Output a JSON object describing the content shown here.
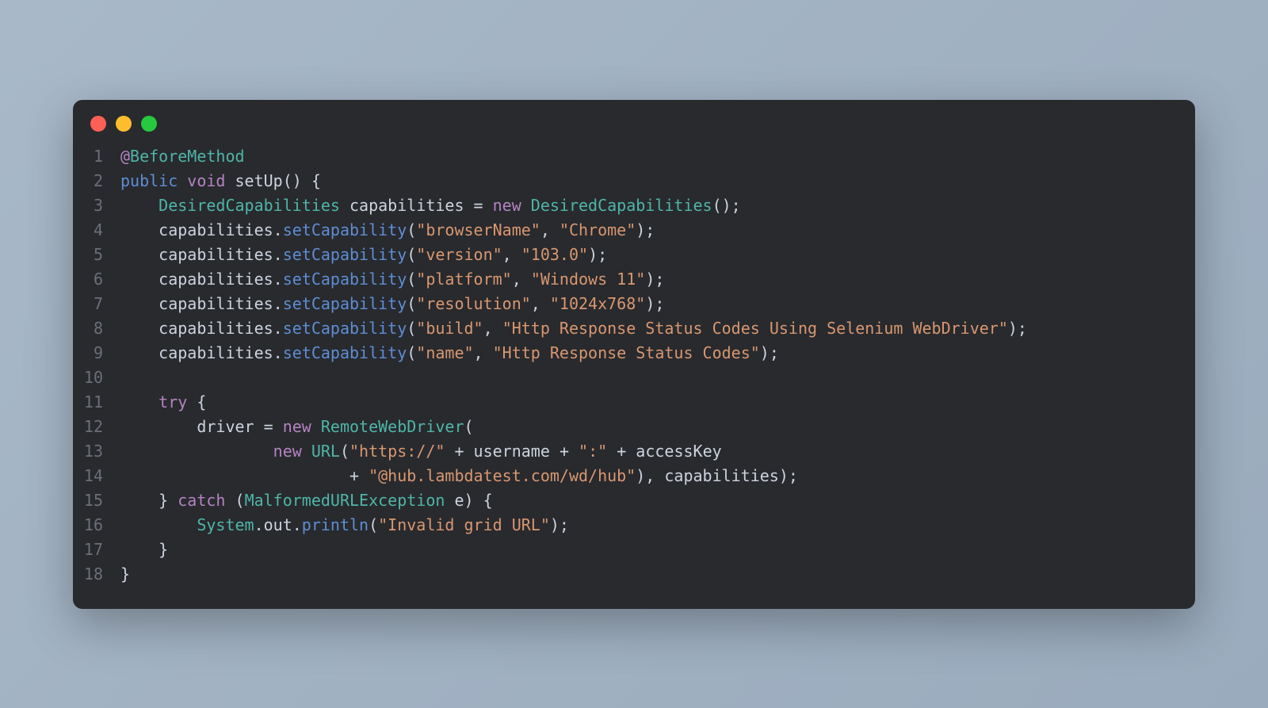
{
  "window": {
    "dots": {
      "red": "#ff5f56",
      "yellow": "#ffbd2e",
      "green": "#27c93f"
    }
  },
  "code": {
    "lines": [
      {
        "n": "1",
        "tokens": [
          {
            "t": "@",
            "c": "annotation-at"
          },
          {
            "t": "BeforeMethod",
            "c": "annotation-name"
          }
        ]
      },
      {
        "n": "2",
        "tokens": [
          {
            "t": "public",
            "c": "keyword-def"
          },
          {
            "t": " ",
            "c": "punct"
          },
          {
            "t": "void",
            "c": "keyword"
          },
          {
            "t": " ",
            "c": "punct"
          },
          {
            "t": "setUp",
            "c": "method-def"
          },
          {
            "t": "() {",
            "c": "punct"
          }
        ]
      },
      {
        "n": "3",
        "tokens": [
          {
            "t": "    ",
            "c": "punct"
          },
          {
            "t": "DesiredCapabilities",
            "c": "type"
          },
          {
            "t": " capabilities ",
            "c": "var"
          },
          {
            "t": "=",
            "c": "op"
          },
          {
            "t": " ",
            "c": "punct"
          },
          {
            "t": "new",
            "c": "keyword"
          },
          {
            "t": " ",
            "c": "punct"
          },
          {
            "t": "DesiredCapabilities",
            "c": "type"
          },
          {
            "t": "();",
            "c": "punct"
          }
        ]
      },
      {
        "n": "4",
        "tokens": [
          {
            "t": "    capabilities.",
            "c": "var"
          },
          {
            "t": "setCapability",
            "c": "method"
          },
          {
            "t": "(",
            "c": "punct"
          },
          {
            "t": "\"browserName\"",
            "c": "string"
          },
          {
            "t": ", ",
            "c": "punct"
          },
          {
            "t": "\"Chrome\"",
            "c": "string"
          },
          {
            "t": ");",
            "c": "punct"
          }
        ]
      },
      {
        "n": "5",
        "tokens": [
          {
            "t": "    capabilities.",
            "c": "var"
          },
          {
            "t": "setCapability",
            "c": "method"
          },
          {
            "t": "(",
            "c": "punct"
          },
          {
            "t": "\"version\"",
            "c": "string"
          },
          {
            "t": ", ",
            "c": "punct"
          },
          {
            "t": "\"103.0\"",
            "c": "string"
          },
          {
            "t": ");",
            "c": "punct"
          }
        ]
      },
      {
        "n": "6",
        "tokens": [
          {
            "t": "    capabilities.",
            "c": "var"
          },
          {
            "t": "setCapability",
            "c": "method"
          },
          {
            "t": "(",
            "c": "punct"
          },
          {
            "t": "\"platform\"",
            "c": "string"
          },
          {
            "t": ", ",
            "c": "punct"
          },
          {
            "t": "\"Windows 11\"",
            "c": "string"
          },
          {
            "t": ");",
            "c": "punct"
          }
        ]
      },
      {
        "n": "7",
        "tokens": [
          {
            "t": "    capabilities.",
            "c": "var"
          },
          {
            "t": "setCapability",
            "c": "method"
          },
          {
            "t": "(",
            "c": "punct"
          },
          {
            "t": "\"resolution\"",
            "c": "string"
          },
          {
            "t": ", ",
            "c": "punct"
          },
          {
            "t": "\"1024x768\"",
            "c": "string"
          },
          {
            "t": ");",
            "c": "punct"
          }
        ]
      },
      {
        "n": "8",
        "tokens": [
          {
            "t": "    capabilities.",
            "c": "var"
          },
          {
            "t": "setCapability",
            "c": "method"
          },
          {
            "t": "(",
            "c": "punct"
          },
          {
            "t": "\"build\"",
            "c": "string"
          },
          {
            "t": ", ",
            "c": "punct"
          },
          {
            "t": "\"Http Response Status Codes Using Selenium WebDriver\"",
            "c": "string"
          },
          {
            "t": ");",
            "c": "punct"
          }
        ]
      },
      {
        "n": "9",
        "tokens": [
          {
            "t": "    capabilities.",
            "c": "var"
          },
          {
            "t": "setCapability",
            "c": "method"
          },
          {
            "t": "(",
            "c": "punct"
          },
          {
            "t": "\"name\"",
            "c": "string"
          },
          {
            "t": ", ",
            "c": "punct"
          },
          {
            "t": "\"Http Response Status Codes\"",
            "c": "string"
          },
          {
            "t": ");",
            "c": "punct"
          }
        ]
      },
      {
        "n": "10",
        "tokens": [
          {
            "t": "",
            "c": "punct"
          }
        ]
      },
      {
        "n": "11",
        "tokens": [
          {
            "t": "    ",
            "c": "punct"
          },
          {
            "t": "try",
            "c": "keyword"
          },
          {
            "t": " {",
            "c": "punct"
          }
        ]
      },
      {
        "n": "12",
        "tokens": [
          {
            "t": "        driver ",
            "c": "var"
          },
          {
            "t": "=",
            "c": "op"
          },
          {
            "t": " ",
            "c": "punct"
          },
          {
            "t": "new",
            "c": "keyword"
          },
          {
            "t": " ",
            "c": "punct"
          },
          {
            "t": "RemoteWebDriver",
            "c": "type"
          },
          {
            "t": "(",
            "c": "punct"
          }
        ]
      },
      {
        "n": "13",
        "tokens": [
          {
            "t": "                ",
            "c": "punct"
          },
          {
            "t": "new",
            "c": "keyword"
          },
          {
            "t": " ",
            "c": "punct"
          },
          {
            "t": "URL",
            "c": "type"
          },
          {
            "t": "(",
            "c": "punct"
          },
          {
            "t": "\"https://\"",
            "c": "string"
          },
          {
            "t": " ",
            "c": "punct"
          },
          {
            "t": "+",
            "c": "op"
          },
          {
            "t": " username ",
            "c": "var"
          },
          {
            "t": "+",
            "c": "op"
          },
          {
            "t": " ",
            "c": "punct"
          },
          {
            "t": "\":\"",
            "c": "string"
          },
          {
            "t": " ",
            "c": "punct"
          },
          {
            "t": "+",
            "c": "op"
          },
          {
            "t": " accessKey",
            "c": "var"
          }
        ]
      },
      {
        "n": "14",
        "tokens": [
          {
            "t": "                        ",
            "c": "punct"
          },
          {
            "t": "+",
            "c": "op"
          },
          {
            "t": " ",
            "c": "punct"
          },
          {
            "t": "\"@hub.lambdatest.com/wd/hub\"",
            "c": "string"
          },
          {
            "t": "), capabilities);",
            "c": "punct"
          }
        ]
      },
      {
        "n": "15",
        "tokens": [
          {
            "t": "    } ",
            "c": "punct"
          },
          {
            "t": "catch",
            "c": "keyword"
          },
          {
            "t": " (",
            "c": "punct"
          },
          {
            "t": "MalformedURLException",
            "c": "type"
          },
          {
            "t": " e) {",
            "c": "punct"
          }
        ]
      },
      {
        "n": "16",
        "tokens": [
          {
            "t": "        ",
            "c": "punct"
          },
          {
            "t": "System",
            "c": "object"
          },
          {
            "t": ".out.",
            "c": "var"
          },
          {
            "t": "println",
            "c": "method"
          },
          {
            "t": "(",
            "c": "punct"
          },
          {
            "t": "\"Invalid grid URL\"",
            "c": "string"
          },
          {
            "t": ");",
            "c": "punct"
          }
        ]
      },
      {
        "n": "17",
        "tokens": [
          {
            "t": "    }",
            "c": "punct"
          }
        ]
      },
      {
        "n": "18",
        "tokens": [
          {
            "t": "}",
            "c": "punct"
          }
        ]
      }
    ]
  }
}
